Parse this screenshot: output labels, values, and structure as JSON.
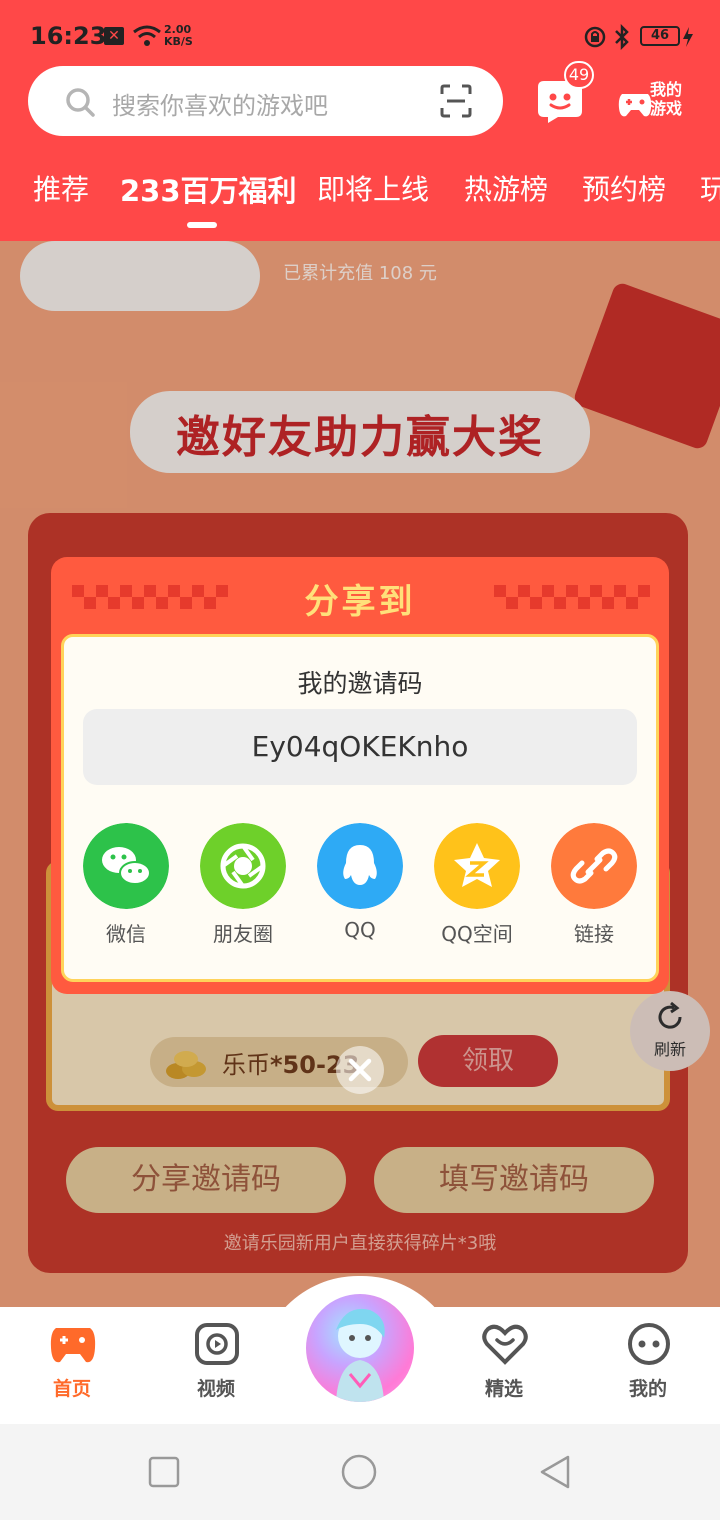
{
  "status_bar": {
    "time": "16:23",
    "net_speed_value": "2.00",
    "net_speed_unit": "KB/S",
    "battery": "46"
  },
  "search": {
    "placeholder": "搜索你喜欢的游戏吧"
  },
  "header": {
    "message_badge": "49",
    "my_games_line1": "我的",
    "my_games_line2": "游戏"
  },
  "tabs": [
    {
      "label": "推荐"
    },
    {
      "label": "233百万福利",
      "active": true
    },
    {
      "label": "即将上线"
    },
    {
      "label": "热游榜"
    },
    {
      "label": "预约榜"
    },
    {
      "label": "玩"
    }
  ],
  "content": {
    "recharge_text": "已累计充值 108 元",
    "event_title": "邀好友助力赢大奖",
    "reward_prefix": "乐币",
    "reward_amount": "*50-23",
    "claim_label": "领取",
    "share_code_label": "分享邀请码",
    "enter_code_label": "填写邀请码",
    "invite_note": "邀请乐园新用户直接获得碎片*3哦",
    "refresh_label": "刷新"
  },
  "modal": {
    "title": "分享到",
    "invite_label": "我的邀请码",
    "invite_code": "Ey04qOKEKnho",
    "share_options": [
      {
        "label": "微信",
        "icon": "wechat-icon",
        "color": "#2dc24a"
      },
      {
        "label": "朋友圈",
        "icon": "moments-icon",
        "color": "#6ed02a"
      },
      {
        "label": "QQ",
        "icon": "qq-icon",
        "color": "#2eaaf5"
      },
      {
        "label": "QQ空间",
        "icon": "qzone-icon",
        "color": "#ffc21a"
      },
      {
        "label": "链接",
        "icon": "link-icon",
        "color": "#ff7a3c"
      }
    ]
  },
  "bottom_nav": [
    {
      "label": "首页",
      "icon": "gamepad-icon",
      "active": true
    },
    {
      "label": "视频",
      "icon": "video-icon"
    },
    {
      "label": "精选",
      "icon": "heart-icon"
    },
    {
      "label": "我的",
      "icon": "face-icon"
    }
  ],
  "colors": {
    "brand_red": "#ff4848",
    "accent_orange": "#ff6a2a",
    "modal_red": "#ff5a3f"
  }
}
